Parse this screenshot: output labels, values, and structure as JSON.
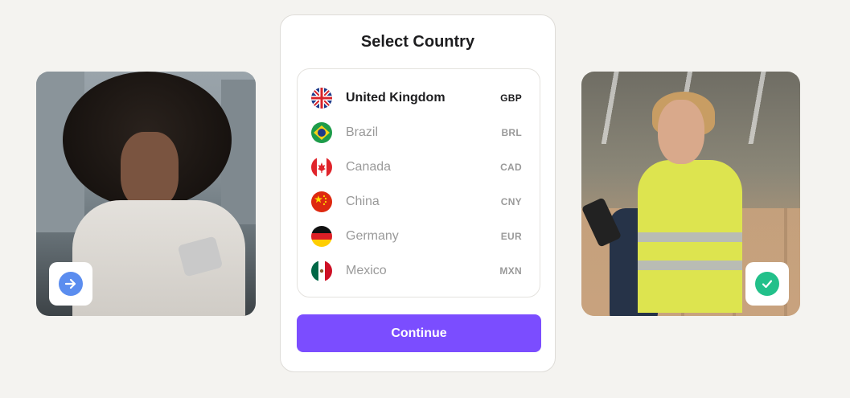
{
  "card": {
    "title": "Select Country",
    "continue_label": "Continue",
    "accent_color": "#7b4dff"
  },
  "countries": [
    {
      "name": "United Kingdom",
      "code": "GBP",
      "flag_icon": "uk-flag-icon",
      "selected": true
    },
    {
      "name": "Brazil",
      "code": "BRL",
      "flag_icon": "brazil-flag-icon",
      "selected": false
    },
    {
      "name": "Canada",
      "code": "CAD",
      "flag_icon": "canada-flag-icon",
      "selected": false
    },
    {
      "name": "China",
      "code": "CNY",
      "flag_icon": "china-flag-icon",
      "selected": false
    },
    {
      "name": "Germany",
      "code": "EUR",
      "flag_icon": "germany-flag-icon",
      "selected": false
    },
    {
      "name": "Mexico",
      "code": "MXN",
      "flag_icon": "mexico-flag-icon",
      "selected": false
    }
  ],
  "badges": {
    "left_icon": "arrow-right-icon",
    "left_color": "#5b8def",
    "right_icon": "check-icon",
    "right_color": "#22c08a"
  }
}
